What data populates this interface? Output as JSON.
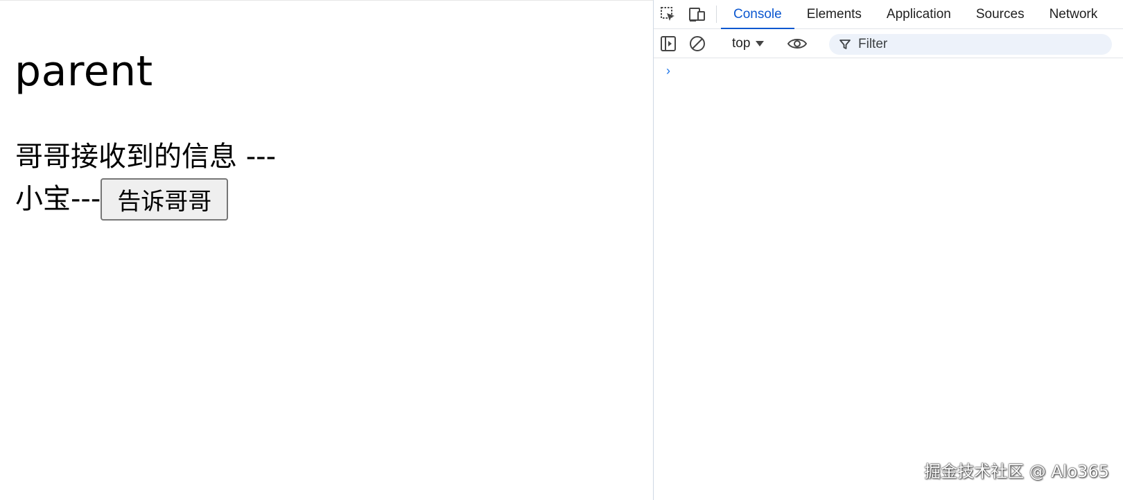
{
  "page": {
    "title": "parent",
    "message_line": "哥哥接收到的信息 ---",
    "second_line_text": "小宝---",
    "tell_button_label": "告诉哥哥"
  },
  "devtools": {
    "tabs": [
      {
        "label": "Console",
        "active": true
      },
      {
        "label": "Elements",
        "active": false
      },
      {
        "label": "Application",
        "active": false
      },
      {
        "label": "Sources",
        "active": false
      },
      {
        "label": "Network",
        "active": false
      }
    ],
    "toolbar": {
      "context_label": "top",
      "filter_placeholder": "Filter"
    },
    "console_prompt": "›",
    "icons": {
      "inspect": "inspect-element-icon",
      "device": "device-toolbar-icon",
      "sidebar": "show-sidebar-icon",
      "clear": "clear-console-icon",
      "eye": "live-expression-eye-icon",
      "filter": "filter-funnel-icon"
    },
    "accent_color": "#0b57d0"
  },
  "watermark": "掘金技术社区 @ Alo365"
}
